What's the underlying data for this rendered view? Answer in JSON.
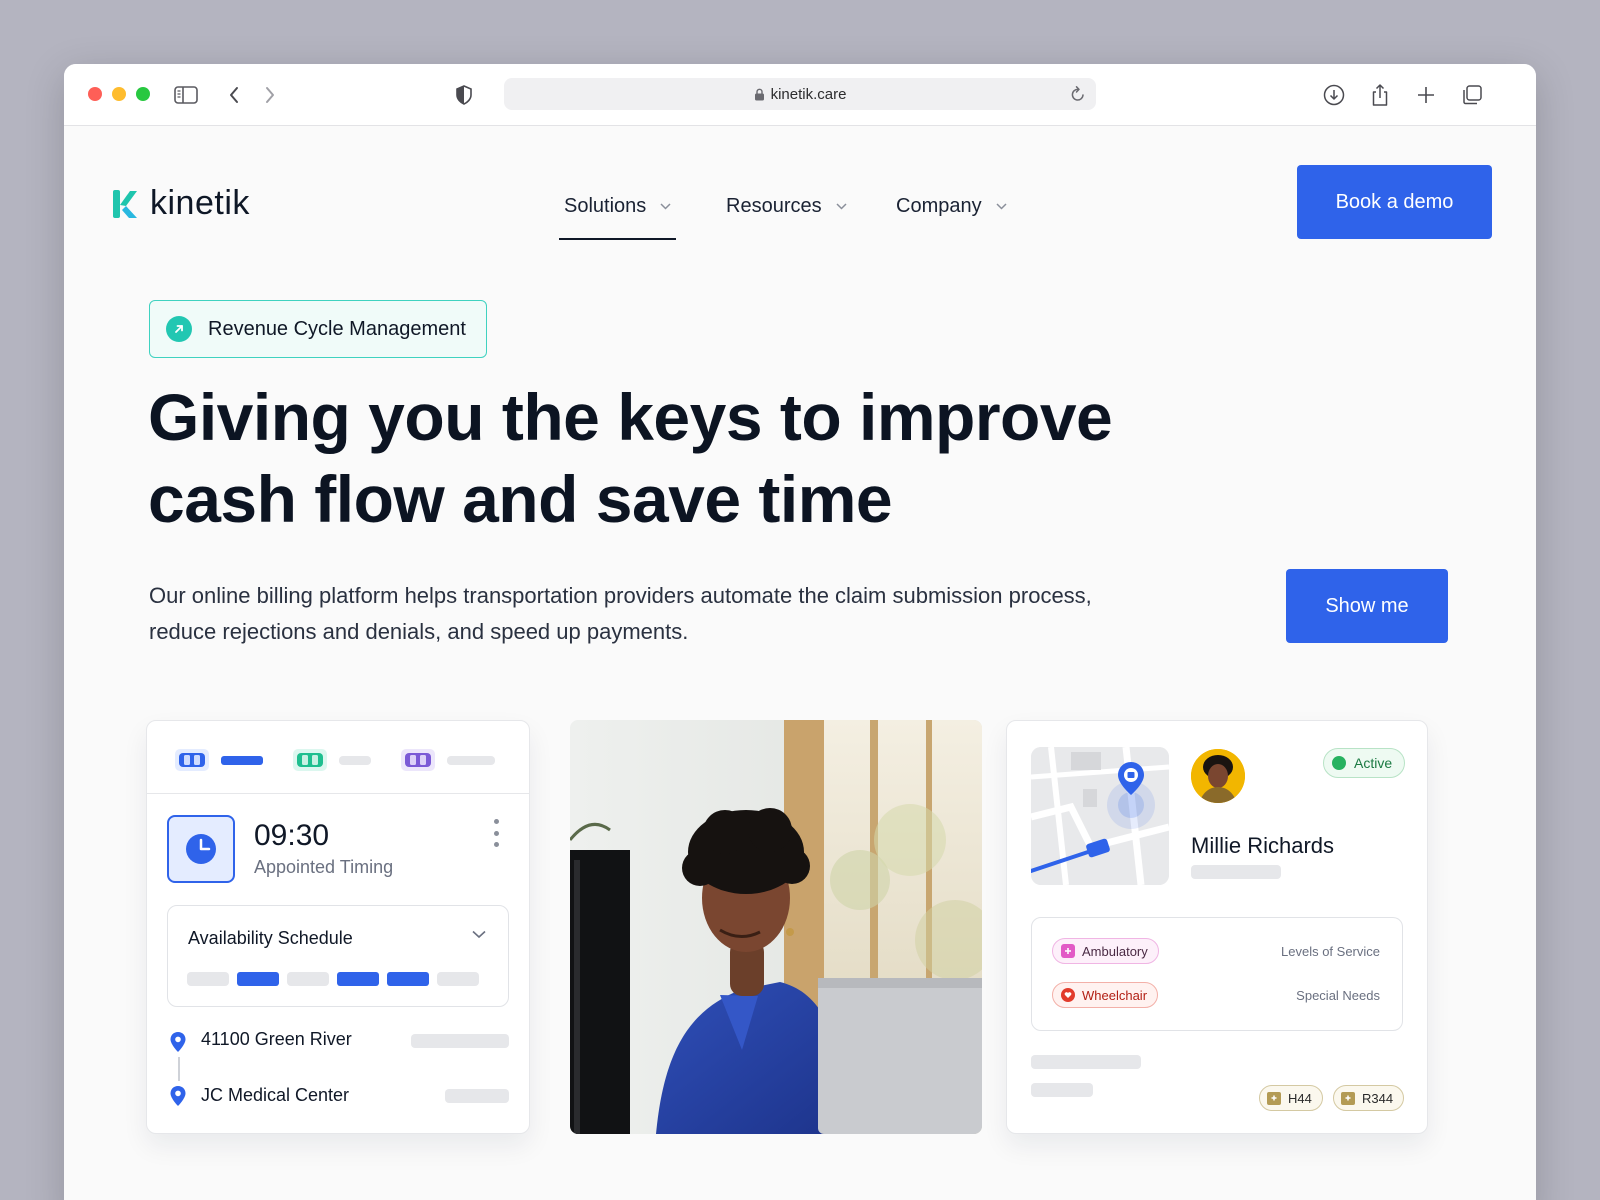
{
  "browser": {
    "url": "kinetik.care"
  },
  "site": {
    "logo_text": "kinetik",
    "nav": [
      {
        "label": "Solutions",
        "active": true
      },
      {
        "label": "Resources",
        "active": false
      },
      {
        "label": "Company",
        "active": false
      }
    ],
    "cta_label": "Book a demo"
  },
  "hero": {
    "badge_label": "Revenue Cycle Management",
    "title_line1": "Giving you the keys to improve",
    "title_line2": "cash flow and save time",
    "subtitle": "Our online billing platform helps transportation providers automate the claim submission process, reduce rejections and denials, and speed up payments.",
    "button_label": "Show me"
  },
  "schedule_card": {
    "time": "09:30",
    "time_label": "Appointed Timing",
    "availability_title": "Availability Schedule",
    "route": [
      {
        "label": "41100 Green River"
      },
      {
        "label": "JC Medical Center"
      }
    ]
  },
  "patient_card": {
    "status": "Active",
    "name": "Millie Richards",
    "levels": [
      {
        "tag": "Ambulatory",
        "label": "Levels of Service"
      },
      {
        "tag": "Wheelchair",
        "label": "Special Needs"
      }
    ],
    "codes": [
      "H44",
      "R344"
    ]
  },
  "colors": {
    "brand_blue": "#2f63ea",
    "brand_teal": "#22c7b2",
    "status_green": "#27b260"
  }
}
